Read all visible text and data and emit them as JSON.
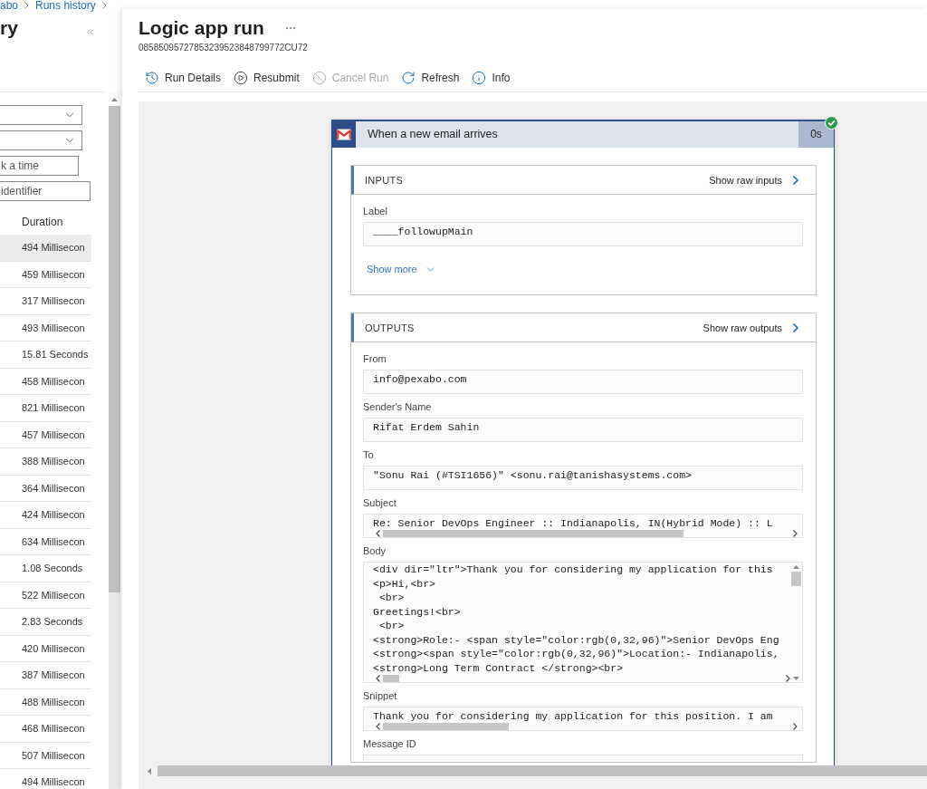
{
  "breadcrumb": [
    "abo",
    "Runs history"
  ],
  "side_panel": {
    "title": "ry",
    "filters": [
      {
        "kind": "dropdown"
      },
      {
        "kind": "dropdown"
      },
      {
        "kind": "input",
        "placeholder": "k a time"
      },
      {
        "kind": "input",
        "placeholder": "identifier"
      }
    ],
    "column": "Duration",
    "rows": [
      {
        "duration": "494 Millisecon",
        "selected": true
      },
      {
        "duration": "459 Millisecon",
        "selected": false
      },
      {
        "duration": "317 Millisecon",
        "selected": false
      },
      {
        "duration": "493 Millisecon",
        "selected": false
      },
      {
        "duration": "15.81 Seconds",
        "selected": false
      },
      {
        "duration": "458 Millisecon",
        "selected": false
      },
      {
        "duration": "821 Millisecon",
        "selected": false
      },
      {
        "duration": "457 Millisecon",
        "selected": false
      },
      {
        "duration": "388 Millisecon",
        "selected": false
      },
      {
        "duration": "364 Millisecon",
        "selected": false
      },
      {
        "duration": "424 Millisecon",
        "selected": false
      },
      {
        "duration": "634 Millisecon",
        "selected": false
      },
      {
        "duration": "1.08 Seconds",
        "selected": false
      },
      {
        "duration": "522 Millisecon",
        "selected": false
      },
      {
        "duration": "2.83 Seconds",
        "selected": false
      },
      {
        "duration": "420 Millisecon",
        "selected": false
      },
      {
        "duration": "387 Millisecon",
        "selected": false
      },
      {
        "duration": "488 Millisecon",
        "selected": false
      },
      {
        "duration": "468 Millisecon",
        "selected": false
      },
      {
        "duration": "507 Millisecon",
        "selected": false
      },
      {
        "duration": "494 Millisecon",
        "selected": false
      }
    ]
  },
  "blade": {
    "title": "Logic app run",
    "subtitle": "08585095727853239523848799772CU72",
    "toolbar": [
      {
        "kind": "history",
        "label": "Run Details",
        "disabled": false
      },
      {
        "kind": "resubmit",
        "label": "Resubmit",
        "disabled": false
      },
      {
        "kind": "cancel",
        "label": "Cancel Run",
        "disabled": true
      },
      {
        "kind": "refresh",
        "label": "Refresh",
        "disabled": false
      },
      {
        "kind": "info",
        "label": "Info",
        "disabled": false
      }
    ]
  },
  "step": {
    "title": "When a new email arrives",
    "duration": "0s",
    "succeeded": true,
    "inputs": {
      "heading": "INPUTS",
      "raw_link": "Show raw inputs",
      "fields": [
        {
          "kind": "text",
          "label": "Label",
          "value": "____followupMain"
        }
      ],
      "more_link": "Show more"
    },
    "outputs": {
      "heading": "OUTPUTS",
      "raw_link": "Show raw outputs",
      "fields": [
        {
          "kind": "text",
          "label": "From",
          "value": "info@pexabo.com"
        },
        {
          "kind": "text",
          "label": "Sender's Name",
          "value": "Rifat Erdem Sahin"
        },
        {
          "kind": "text",
          "label": "To",
          "value": "\"Sonu Rai (#TSI1656)\" <sonu.rai@tanishasystems.com>"
        },
        {
          "kind": "scroll",
          "label": "Subject",
          "value": "Re: Senior DevOps Engineer :: Indianapolis, IN(Hybrid Mode) :: L"
        },
        {
          "kind": "code",
          "label": "Body",
          "lines": [
            "<div dir=\"ltr\">Thank you for considering my application for this",
            "<p>Hi,<br>",
            " <br>",
            "Greetings!<br>",
            " <br>",
            "<strong>Role:- <span style=\"color:rgb(0,32,96)\">Senior DevOps Eng",
            "<strong><span style=\"color:rgb(0,32,96)\">Location:- Indianapolis,",
            "<strong>Long Term Contract </strong><br>"
          ]
        },
        {
          "kind": "scroll",
          "label": "Snippet",
          "value": "Thank you for considering my application for this position. I am"
        },
        {
          "kind": "partial",
          "label": "Message ID"
        }
      ]
    }
  }
}
